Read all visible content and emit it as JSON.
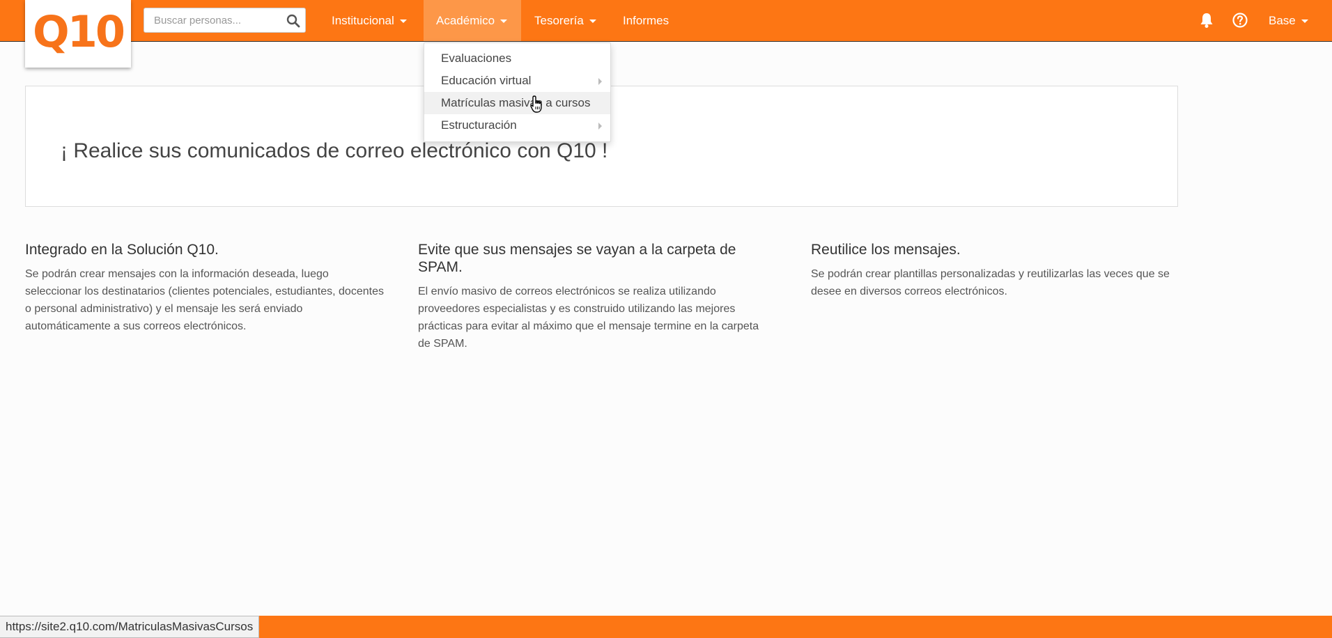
{
  "brand": {
    "logo_text": "Q10",
    "accent": "#fd7614"
  },
  "search": {
    "placeholder": "Buscar personas...",
    "value": "",
    "icon": "search-icon"
  },
  "nav": {
    "items": [
      {
        "label": "Institucional",
        "has_caret": true
      },
      {
        "label": "Académico",
        "has_caret": true,
        "active": true
      },
      {
        "label": "Tesorería",
        "has_caret": true
      },
      {
        "label": "Informes",
        "has_caret": false
      }
    ],
    "right": {
      "bell_icon": "bell-icon",
      "help_icon": "help-circle-icon",
      "user_label": "Base"
    }
  },
  "dropdown": {
    "items": [
      {
        "label": "Evaluaciones",
        "submenu": false
      },
      {
        "label": "Educación virtual",
        "submenu": true
      },
      {
        "label": "Matrículas masivas a cursos",
        "submenu": false,
        "hovered": true
      },
      {
        "label": "Estructuración",
        "submenu": true
      }
    ]
  },
  "banner": {
    "headline": "¡ Realice sus comunicados de correo electrónico con Q10 !"
  },
  "features": [
    {
      "title": "Integrado en la Solución Q10.",
      "body": "Se podrán crear mensajes con la información deseada, luego seleccionar los destinatarios (clientes potenciales, estudiantes, docentes o personal administrativo) y el mensaje les será enviado automáticamente a sus correos electrónicos."
    },
    {
      "title": "Evite que sus mensajes se vayan a la carpeta de SPAM.",
      "body": "El envío masivo de correos electrónicos se realiza utilizando proveedores especialistas y es construido utilizando las mejores prácticas para evitar al máximo que el mensaje termine en la carpeta de SPAM."
    },
    {
      "title": "Reutilice los mensajes.",
      "body": "Se podrán crear plantillas personalizadas y reutilizarlas las veces que se desee en diversos correos electrónicos."
    }
  ],
  "status": {
    "url": "https://site2.q10.com/MatriculasMasivasCursos"
  }
}
